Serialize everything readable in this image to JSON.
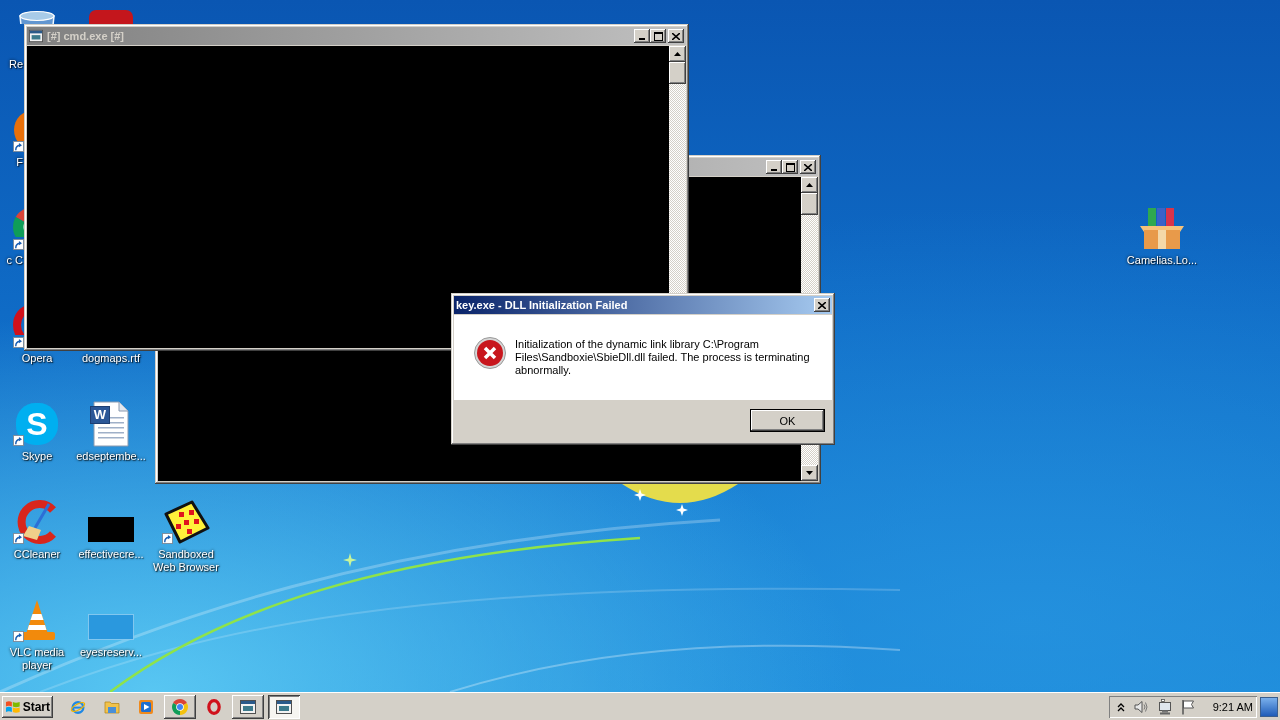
{
  "desktop": {
    "icons": [
      {
        "kind": "recycle-bin",
        "label": "Re",
        "shortcut": false,
        "partly_hidden": true
      },
      {
        "kind": "firefox",
        "label": "F",
        "shortcut": true,
        "partly_hidden": true
      },
      {
        "kind": "chrome",
        "label": "c C",
        "shortcut": true,
        "partly_hidden": true
      },
      {
        "kind": "opera",
        "label": "Opera",
        "shortcut": true,
        "partly_hidden": false
      },
      {
        "kind": "skype",
        "glyph": "S",
        "label": "Skype",
        "shortcut": true,
        "partly_hidden": false
      },
      {
        "kind": "ccleaner",
        "label": "CCleaner",
        "shortcut": true,
        "partly_hidden": false
      },
      {
        "kind": "vlc",
        "label": "VLC media player",
        "shortcut": true,
        "partly_hidden": false
      },
      {
        "kind": "red-app",
        "shortcut": false
      },
      {
        "label": "dogmaps.rtf",
        "shortcut": false,
        "partly_hidden": false
      },
      {
        "kind": "word-doc",
        "glyph": "W",
        "label": "edseptembe...",
        "shortcut": false,
        "partly_hidden": false
      },
      {
        "kind": "black-thumbnail",
        "label": "effectivecre...",
        "shortcut": false,
        "partly_hidden": false
      },
      {
        "kind": "blank-thumbnail",
        "label": "eyesreserv...",
        "shortcut": false,
        "partly_hidden": false
      },
      {
        "kind": "sandboxie",
        "label": "Sandboxed Web Browser",
        "shortcut": true,
        "partly_hidden": false
      },
      {
        "kind": "archive",
        "label": "Camelias.Lo...",
        "shortcut": false,
        "partly_hidden": false
      }
    ]
  },
  "windows": [
    {
      "title": "[#] cmd.exe [#]",
      "active": false
    },
    {
      "active": false
    }
  ],
  "dialog": {
    "title": "key.exe - DLL Initialization Failed",
    "active": true,
    "kind": "error",
    "message": "Initialization of the dynamic link library C:\\Program Files\\Sandboxie\\SbieDll.dll failed. The process is terminating abnormally.",
    "buttons": [
      "OK"
    ]
  },
  "taskbar": {
    "start": "Start",
    "pinned": [
      {
        "kind": "ie",
        "running": false
      },
      {
        "kind": "folder",
        "running": false
      },
      {
        "kind": "media-player",
        "running": false
      },
      {
        "kind": "chrome",
        "running": true
      },
      {
        "kind": "opera",
        "running": false
      }
    ],
    "window_buttons": [
      {
        "selected": false
      },
      {
        "selected": true
      }
    ],
    "clock": "9:21 AM"
  }
}
